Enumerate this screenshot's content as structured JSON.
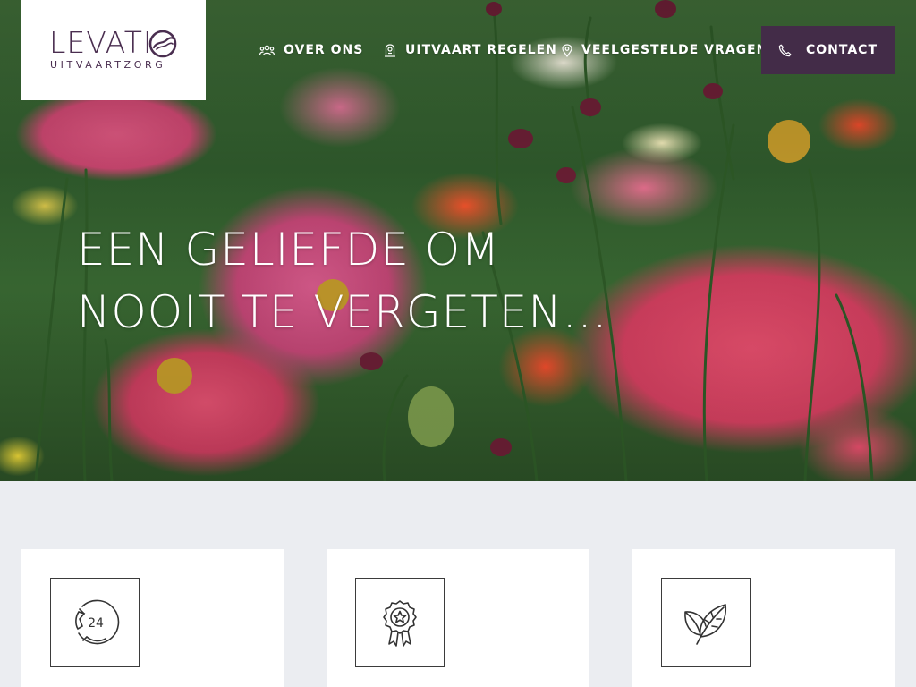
{
  "brand": {
    "name_prefix": "LEVATI",
    "tagline": "UITVAARTZORG",
    "color": "#4a2e50"
  },
  "nav": {
    "items": [
      {
        "label": "OVER ONS",
        "icon": "people-icon"
      },
      {
        "label": "UITVAART REGELEN",
        "icon": "ribbon-badge-icon"
      },
      {
        "label": "VEELGESTELDE VRAGEN",
        "icon": "map-pin-icon"
      }
    ],
    "contact": {
      "label": "CONTACT",
      "icon": "phone-icon",
      "background": "#432c48"
    }
  },
  "hero": {
    "title_line_1": "EEN GELIEFDE OM",
    "title_line_2": "NOOIT TE VERGETEN..."
  },
  "cards": [
    {
      "icon": "phone-24-hours-icon"
    },
    {
      "icon": "award-rosette-icon"
    },
    {
      "icon": "leaf-icon"
    }
  ],
  "colors": {
    "page_background": "#ebedf1",
    "card_background": "#ffffff",
    "accent": "#432c48"
  }
}
